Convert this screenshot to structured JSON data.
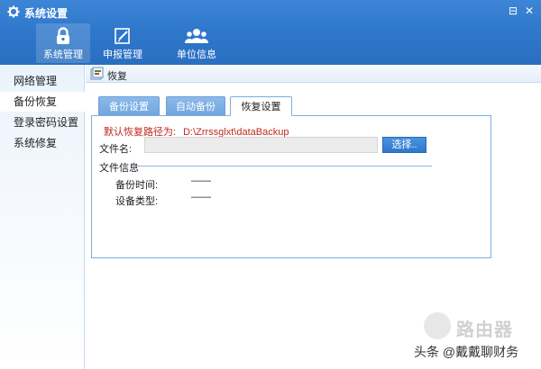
{
  "window": {
    "title": "系统设置",
    "maximize_glyph": "⊟",
    "close_glyph": "✕"
  },
  "nav": {
    "items": [
      {
        "label": "系统管理",
        "icon": "lock-icon",
        "active": true
      },
      {
        "label": "申报管理",
        "icon": "edit-icon",
        "active": false
      },
      {
        "label": "单位信息",
        "icon": "users-icon",
        "active": false
      }
    ]
  },
  "sidebar": {
    "items": [
      {
        "label": "网络管理"
      },
      {
        "label": "备份恢复",
        "active": true
      },
      {
        "label": "登录密码设置"
      },
      {
        "label": "系统修复"
      }
    ]
  },
  "breadcrumb": {
    "label": "恢复"
  },
  "tabs": [
    {
      "label": "备份设置"
    },
    {
      "label": "自动备份"
    },
    {
      "label": "恢复设置",
      "active": true
    }
  ],
  "restore": {
    "default_path_label": "默认恢复路径为:",
    "default_path_value": "D:\\Zrrssglxt\\dataBackup",
    "file_name_label": "文件名:",
    "file_name_value": "",
    "choose_button": "选择..",
    "file_info_label": "文件信息",
    "backup_time_label": "备份时间:",
    "backup_time_value": "——",
    "device_type_label": "设备类型:",
    "device_type_value": "——"
  },
  "watermark": {
    "brand": "路由器",
    "credit": "头条 @戴戴聊财务"
  },
  "colors": {
    "titlebar": "#2f78cc",
    "accent_button": "#2f78cc",
    "path_text": "#c0281e",
    "tab_inactive": "#7aaee0"
  }
}
